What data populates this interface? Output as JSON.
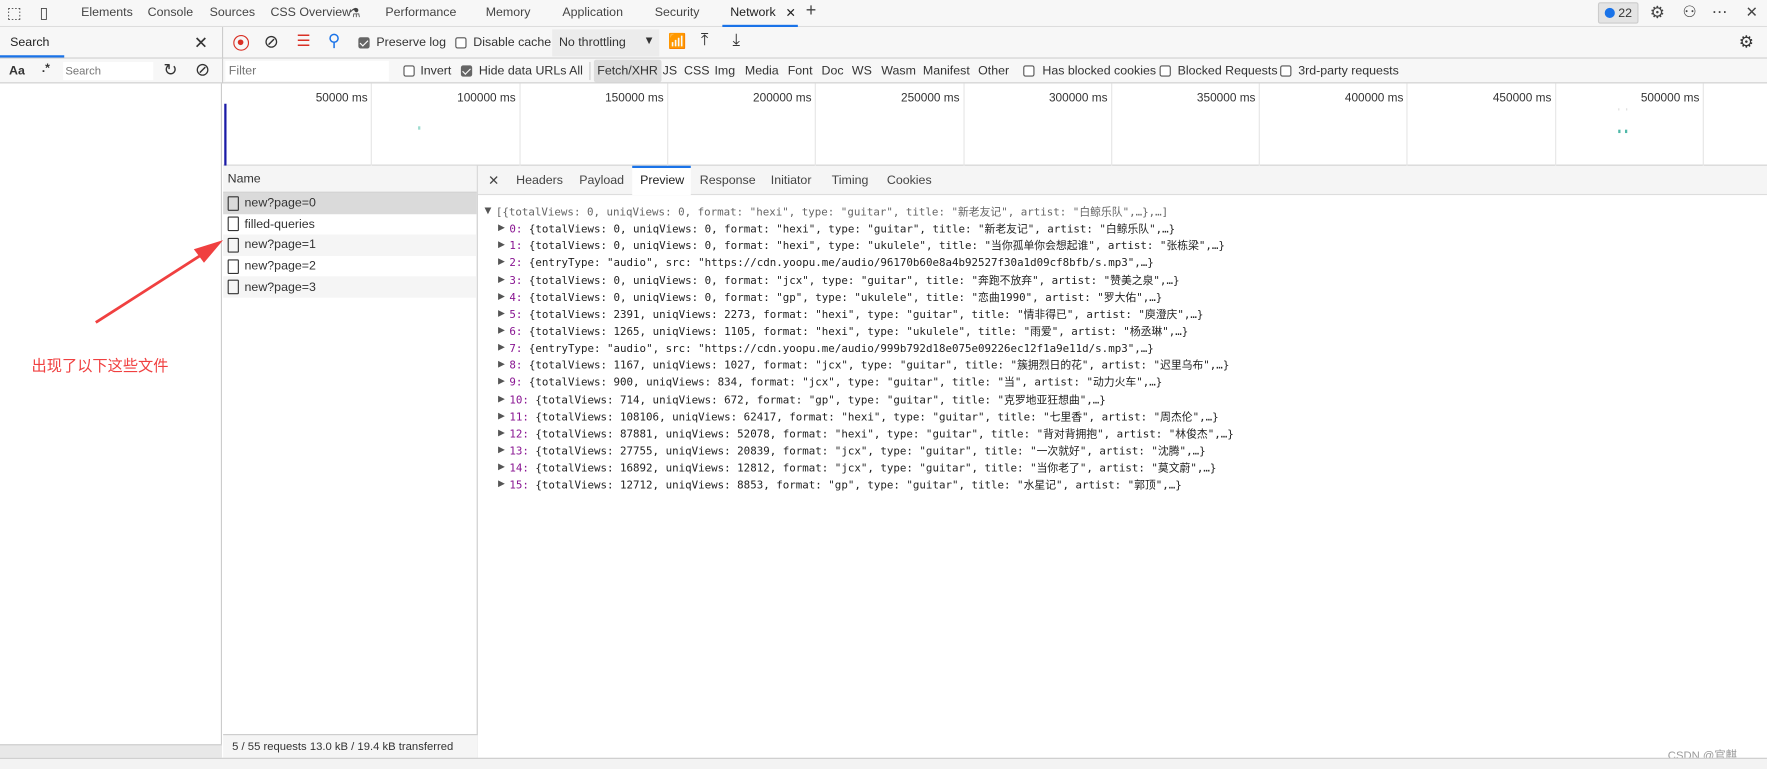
{
  "tabbar": {
    "tabs": [
      "Elements",
      "Console",
      "Sources",
      "CSS Overview",
      "Performance",
      "Memory",
      "Application",
      "Security",
      "Network"
    ],
    "selected": "Network",
    "issues_count": "22"
  },
  "search_panel": {
    "tab": "Search",
    "case_label": "Aa",
    "regex_label": ".*",
    "placeholder": "Search"
  },
  "toolbar": {
    "preserve_log": "Preserve log",
    "preserve_log_checked": true,
    "disable_cache": "Disable cache",
    "disable_cache_checked": false,
    "throttling": "No throttling"
  },
  "filterbar": {
    "placeholder": "Filter",
    "invert": "Invert",
    "hide_data_urls": "Hide data URLs",
    "types": [
      "All",
      "Fetch/XHR",
      "JS",
      "CSS",
      "Img",
      "Media",
      "Font",
      "Doc",
      "WS",
      "Wasm",
      "Manifest",
      "Other"
    ],
    "selected_type": "Fetch/XHR",
    "has_blocked_cookies": "Has blocked cookies",
    "blocked_requests": "Blocked Requests",
    "third_party": "3rd-party requests"
  },
  "timeline": {
    "ticks": [
      "50000 ms",
      "100000 ms",
      "150000 ms",
      "200000 ms",
      "250000 ms",
      "300000 ms",
      "350000 ms",
      "400000 ms",
      "450000 ms",
      "500000 ms"
    ]
  },
  "requests": {
    "header": "Name",
    "items": [
      "new?page=0",
      "filled-queries",
      "new?page=1",
      "new?page=2",
      "new?page=3"
    ],
    "selected": "new?page=0",
    "status": "5 / 55 requests  13.0 kB / 19.4 kB transferred"
  },
  "details": {
    "tabs": [
      "Headers",
      "Payload",
      "Preview",
      "Response",
      "Initiator",
      "Timing",
      "Cookies"
    ],
    "selected": "Preview",
    "root": "[{totalViews: 0, uniqViews: 0, format: \"hexi\", type: \"guitar\", title: \"新老友记\", artist: \"白鲸乐队\",…},…]",
    "rows": [
      {
        "i": "0:",
        "t": "{totalViews: 0, uniqViews: 0, format: \"hexi\", type: \"guitar\", title: \"新老友记\", artist: \"白鲸乐队\",…}"
      },
      {
        "i": "1:",
        "t": "{totalViews: 0, uniqViews: 0, format: \"hexi\", type: \"ukulele\", title: \"当你孤单你会想起谁\", artist: \"张栋梁\",…}"
      },
      {
        "i": "2:",
        "t": "{entryType: \"audio\", src: \"https://cdn.yoopu.me/audio/96170b60e8a4b92527f30a1d09cf8bfb/s.mp3\",…}"
      },
      {
        "i": "3:",
        "t": "{totalViews: 0, uniqViews: 0, format: \"jcx\", type: \"guitar\", title: \"奔跑不放弃\", artist: \"赞美之泉\",…}"
      },
      {
        "i": "4:",
        "t": "{totalViews: 0, uniqViews: 0, format: \"gp\", type: \"ukulele\", title: \"恋曲1990\", artist: \"罗大佑\",…}"
      },
      {
        "i": "5:",
        "t": "{totalViews: 2391, uniqViews: 2273, format: \"hexi\", type: \"guitar\", title: \"情非得已\", artist: \"庾澄庆\",…}"
      },
      {
        "i": "6:",
        "t": "{totalViews: 1265, uniqViews: 1105, format: \"hexi\", type: \"ukulele\", title: \"雨爱\", artist: \"杨丞琳\",…}"
      },
      {
        "i": "7:",
        "t": "{entryType: \"audio\", src: \"https://cdn.yoopu.me/audio/999b792d18e075e09226ec12f1a9e11d/s.mp3\",…}"
      },
      {
        "i": "8:",
        "t": "{totalViews: 1167, uniqViews: 1027, format: \"jcx\", type: \"guitar\", title: \"簇拥烈日的花\", artist: \"迟里乌布\",…}"
      },
      {
        "i": "9:",
        "t": "{totalViews: 900, uniqViews: 834, format: \"jcx\", type: \"guitar\", title: \"当\", artist: \"动力火车\",…}"
      },
      {
        "i": "10:",
        "t": "{totalViews: 714, uniqViews: 672, format: \"gp\", type: \"guitar\", title: \"克罗地亚狂想曲\",…}"
      },
      {
        "i": "11:",
        "t": "{totalViews: 108106, uniqViews: 62417, format: \"hexi\", type: \"guitar\", title: \"七里香\", artist: \"周杰伦\",…}"
      },
      {
        "i": "12:",
        "t": "{totalViews: 87881, uniqViews: 52078, format: \"hexi\", type: \"guitar\", title: \"背对背拥抱\", artist: \"林俊杰\",…}"
      },
      {
        "i": "13:",
        "t": "{totalViews: 27755, uniqViews: 20839, format: \"jcx\", type: \"guitar\", title: \"一次就好\", artist: \"沈腾\",…}"
      },
      {
        "i": "14:",
        "t": "{totalViews: 16892, uniqViews: 12812, format: \"jcx\", type: \"guitar\", title: \"当你老了\", artist: \"莫文蔚\",…}"
      },
      {
        "i": "15:",
        "t": "{totalViews: 12712, uniqViews: 8853, format: \"gp\", type: \"guitar\", title: \"水星记\", artist: \"郭顶\",…}"
      }
    ]
  },
  "annotation": {
    "text": "出现了以下这些文件",
    "color": "#f04040"
  },
  "watermark": "CSDN @官麒",
  "colors": {
    "accent": "#1a73e8",
    "record": "#d93025",
    "annotation": "#f04040"
  }
}
